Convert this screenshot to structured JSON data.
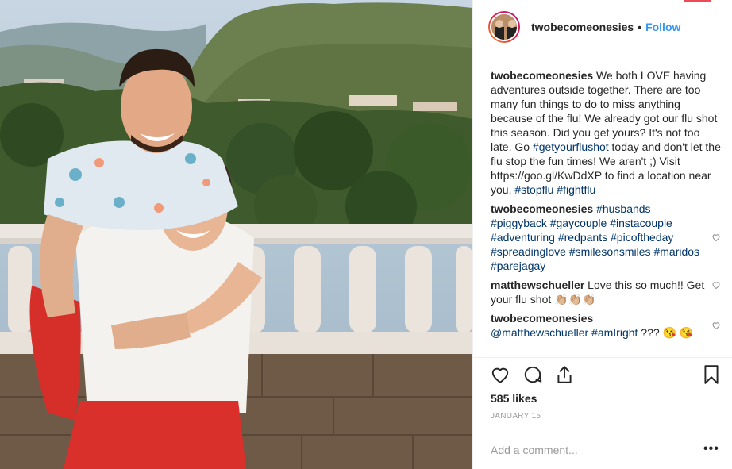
{
  "post": {
    "username": "twobecomeonesies",
    "follow_label": "Follow",
    "separator": "•",
    "caption": {
      "user": "twobecomeonesies",
      "text_before_tag1": " We both LOVE having adventures outside together. There are too many fun things to do to miss anything because of the flu! We already got our flu shot this season. Did you get yours? It's not too late. Go ",
      "tag1": "#getyourflushot",
      "text_after_tag1": " today and don't let the flu stop the fun times! We aren't ;) Visit https://goo.gl/KwDdXP to find a location near you. ",
      "tag2": "#stopflu",
      "tag3": "#fightflu"
    },
    "comments": [
      {
        "user": "twobecomeonesies",
        "tags": [
          "#husbands",
          "#piggyback",
          "#gaycouple",
          "#instacouple",
          "#adventuring",
          "#redpants",
          "#picoftheday",
          "#spreadinglove",
          "#smilesonsmiles",
          "#maridos",
          "#parejagay"
        ]
      },
      {
        "user": "matthewschueller",
        "text": " Love this so much!! Get your flu shot 👏🏼👏🏼👏🏼"
      },
      {
        "user": "twobecomeonesies",
        "mention": "@matthewschueller",
        "tag": "#amIright",
        "text": " ??? 😘 😘"
      }
    ],
    "likes": "585 likes",
    "date": "JANUARY 15",
    "add_comment_placeholder": "Add a comment...",
    "more_label": "•••"
  },
  "icons": {
    "like": "heart-outline-icon",
    "comment": "comment-bubble-icon",
    "share": "share-arrow-icon",
    "save": "bookmark-icon",
    "comment_like": "small-heart-icon"
  },
  "colors": {
    "link": "#003569",
    "follow": "#3897f0",
    "muted": "#999999",
    "notification": "#ed4956"
  }
}
